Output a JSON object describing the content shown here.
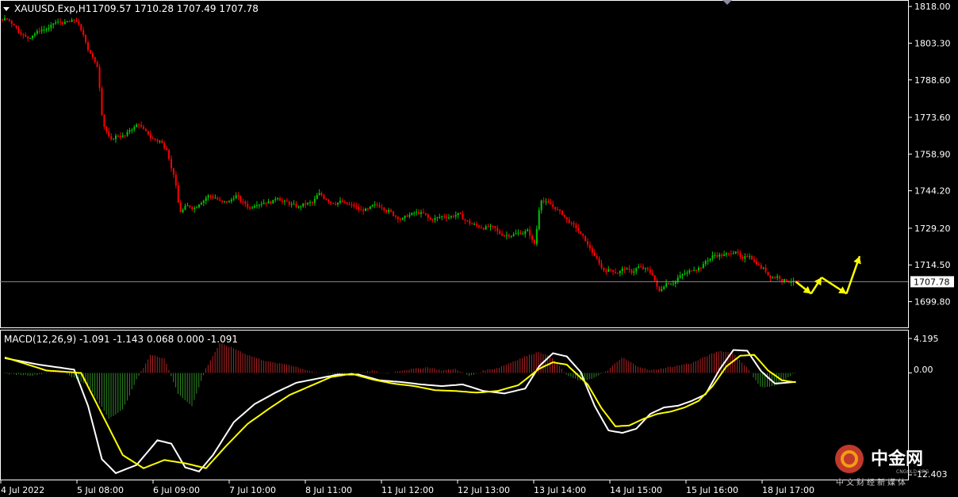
{
  "header": {
    "symbol_tf": "XAUUSD.Exp,H1",
    "ohlc": "1709.57 1710.28 1707.49 1707.78",
    "last_price_badge": "1707.78"
  },
  "macd_header": {
    "label": "MACD(12,26,9) -1.091 -1.143 0.068 0.000 -1.091",
    "top_value": "4.195",
    "zero_value": "0.00",
    "bottom_value": "-12.403"
  },
  "watermark": {
    "brand": "中金网",
    "subtitle": "中文财经新媒体",
    "domain": "CNGOLD.ORG"
  },
  "colors": {
    "background": "#000000",
    "grid_border": "#ffffff",
    "candle_up": "#00c800",
    "candle_down": "#ff0000",
    "macd_hist_pos": "#b22222",
    "macd_hist_neg": "#2e8b22",
    "macd_line": "#ffffff",
    "signal_line": "#ffff00",
    "projection": "#ffff00",
    "price_line": "#8c8ca0"
  },
  "chart_data": [
    {
      "type": "candlestick",
      "title": "XAUUSD.Exp,H1",
      "ylim": [
        1694.9,
        1819.0
      ],
      "y_ticks": [
        1818.0,
        1803.3,
        1788.6,
        1773.6,
        1758.9,
        1744.2,
        1729.2,
        1714.5,
        1699.8
      ],
      "x_tick_labels": [
        "4 Jul 2022",
        "5 Jul 08:00",
        "6 Jul 09:00",
        "7 Jul 10:00",
        "8 Jul 11:00",
        "11 Jul 12:00",
        "12 Jul 13:00",
        "13 Jul 14:00",
        "14 Jul 15:00",
        "15 Jul 16:00",
        "18 Jul 17:00"
      ],
      "close_path": [
        [
          0,
          1813
        ],
        [
          3,
          1806
        ],
        [
          6,
          1810
        ],
        [
          9,
          1812
        ],
        [
          10,
          1813
        ],
        [
          11,
          1806
        ],
        [
          12,
          1799
        ],
        [
          13,
          1795
        ],
        [
          14,
          1770
        ],
        [
          15,
          1765
        ],
        [
          17,
          1767
        ],
        [
          19,
          1771
        ],
        [
          21,
          1766
        ],
        [
          23,
          1760
        ],
        [
          24,
          1752
        ],
        [
          25,
          1736
        ],
        [
          27,
          1738
        ],
        [
          29,
          1742
        ],
        [
          31,
          1740
        ],
        [
          33,
          1741
        ],
        [
          35,
          1738
        ],
        [
          37,
          1740
        ],
        [
          39,
          1741
        ],
        [
          41,
          1739
        ],
        [
          43,
          1738
        ],
        [
          45,
          1742
        ],
        [
          47,
          1740
        ],
        [
          49,
          1739
        ],
        [
          51,
          1736
        ],
        [
          53,
          1739
        ],
        [
          55,
          1737
        ],
        [
          57,
          1733
        ],
        [
          59,
          1735
        ],
        [
          61,
          1733
        ],
        [
          63,
          1734
        ],
        [
          65,
          1734
        ],
        [
          67,
          1731
        ],
        [
          69,
          1730
        ],
        [
          71,
          1728
        ],
        [
          73,
          1726
        ],
        [
          75,
          1727
        ],
        [
          76,
          1722
        ],
        [
          77,
          1740
        ],
        [
          79,
          1737
        ],
        [
          81,
          1733
        ],
        [
          82,
          1730
        ],
        [
          84,
          1722
        ],
        [
          86,
          1712
        ],
        [
          87,
          1712
        ],
        [
          89,
          1712
        ],
        [
          91,
          1714
        ],
        [
          93,
          1711
        ],
        [
          94,
          1705
        ],
        [
          95,
          1706
        ],
        [
          97,
          1709
        ],
        [
          99,
          1713
        ],
        [
          101,
          1716
        ],
        [
          103,
          1719
        ],
        [
          105,
          1721
        ],
        [
          106,
          1716
        ],
        [
          107,
          1718
        ],
        [
          109,
          1712
        ],
        [
          111,
          1709
        ],
        [
          113,
          1709
        ],
        [
          114,
          1707.78
        ]
      ],
      "last_price": 1707.78,
      "projection_path": [
        [
          114,
          1707.78
        ],
        [
          116.2,
          1703
        ],
        [
          117.7,
          1709.5
        ],
        [
          121.3,
          1703
        ],
        [
          123.2,
          1718
        ]
      ]
    },
    {
      "type": "macd",
      "title": "MACD(12,26,9)",
      "values": {
        "macd": -1.091,
        "signal": -1.143,
        "histogram": 0.068,
        "zero": 0.0,
        "osma": -1.091
      },
      "ylim": [
        -12.403,
        4.195
      ],
      "macd_path": [
        [
          0,
          1.8
        ],
        [
          5,
          1.0
        ],
        [
          10,
          0.4
        ],
        [
          12,
          -4.0
        ],
        [
          14,
          -10.5
        ],
        [
          16,
          -12.2
        ],
        [
          19,
          -11.2
        ],
        [
          22,
          -8.2
        ],
        [
          24,
          -8.6
        ],
        [
          26,
          -11.5
        ],
        [
          28,
          -12.0
        ],
        [
          30,
          -10.0
        ],
        [
          33,
          -6.0
        ],
        [
          36,
          -3.8
        ],
        [
          39,
          -2.4
        ],
        [
          42,
          -1.2
        ],
        [
          45,
          -0.7
        ],
        [
          48,
          -0.2
        ],
        [
          51,
          -0.2
        ],
        [
          54,
          -0.9
        ],
        [
          57,
          -1.1
        ],
        [
          60,
          -1.4
        ],
        [
          63,
          -1.6
        ],
        [
          66,
          -1.4
        ],
        [
          69,
          -2.2
        ],
        [
          72,
          -2.5
        ],
        [
          75,
          -1.9
        ],
        [
          77,
          0.8
        ],
        [
          79,
          2.4
        ],
        [
          81,
          2.0
        ],
        [
          83,
          0.1
        ],
        [
          85,
          -4.0
        ],
        [
          87,
          -7.0
        ],
        [
          89,
          -7.3
        ],
        [
          91,
          -6.8
        ],
        [
          93,
          -5.0
        ],
        [
          95,
          -4.2
        ],
        [
          97,
          -4.0
        ],
        [
          99,
          -3.4
        ],
        [
          101,
          -2.6
        ],
        [
          103,
          0.4
        ],
        [
          105,
          2.8
        ],
        [
          107,
          2.7
        ],
        [
          109,
          0.2
        ],
        [
          111,
          -1.3
        ],
        [
          114,
          -1.091
        ]
      ],
      "signal_path": [
        [
          0,
          1.9
        ],
        [
          6,
          0.3
        ],
        [
          11,
          0.0
        ],
        [
          14,
          -5.0
        ],
        [
          17,
          -10.0
        ],
        [
          20,
          -11.6
        ],
        [
          23,
          -10.6
        ],
        [
          26,
          -11.0
        ],
        [
          29,
          -11.6
        ],
        [
          32,
          -8.8
        ],
        [
          35,
          -6.2
        ],
        [
          38,
          -4.4
        ],
        [
          41,
          -2.7
        ],
        [
          44,
          -1.6
        ],
        [
          47,
          -0.5
        ],
        [
          50,
          -0.1
        ],
        [
          53,
          -0.8
        ],
        [
          56,
          -1.3
        ],
        [
          59,
          -1.6
        ],
        [
          62,
          -2.1
        ],
        [
          65,
          -2.2
        ],
        [
          68,
          -2.4
        ],
        [
          71,
          -2.2
        ],
        [
          74,
          -1.5
        ],
        [
          77,
          0.5
        ],
        [
          79,
          1.3
        ],
        [
          81,
          1.0
        ],
        [
          84,
          -1.4
        ],
        [
          86,
          -4.3
        ],
        [
          88,
          -6.5
        ],
        [
          90,
          -6.4
        ],
        [
          92,
          -5.6
        ],
        [
          94,
          -5.0
        ],
        [
          96,
          -4.7
        ],
        [
          98,
          -4.2
        ],
        [
          100,
          -3.4
        ],
        [
          102,
          -1.6
        ],
        [
          104,
          0.8
        ],
        [
          106,
          2.1
        ],
        [
          108,
          2.2
        ],
        [
          110,
          0.3
        ],
        [
          112,
          -0.9
        ],
        [
          114,
          -1.143
        ]
      ],
      "histogram_path": [
        [
          0,
          -0.1
        ],
        [
          4,
          -0.3
        ],
        [
          8,
          0.3
        ],
        [
          12,
          -1.5
        ],
        [
          15,
          -5.5
        ],
        [
          17,
          -4.5
        ],
        [
          19,
          -0.8
        ],
        [
          21,
          2.2
        ],
        [
          23,
          1.8
        ],
        [
          25,
          -2.6
        ],
        [
          27,
          -4.0
        ],
        [
          29,
          0.6
        ],
        [
          31,
          3.6
        ],
        [
          33,
          3.0
        ],
        [
          35,
          2.2
        ],
        [
          37,
          1.6
        ],
        [
          39,
          1.2
        ],
        [
          41,
          1.0
        ],
        [
          43,
          0.5
        ],
        [
          45,
          0.0
        ],
        [
          47,
          -0.1
        ],
        [
          49,
          -0.2
        ],
        [
          51,
          -0.1
        ],
        [
          53,
          0.3
        ],
        [
          55,
          -0.1
        ],
        [
          57,
          0.3
        ],
        [
          59,
          0.5
        ],
        [
          61,
          0.7
        ],
        [
          63,
          0.3
        ],
        [
          65,
          0.5
        ],
        [
          67,
          -0.4
        ],
        [
          69,
          0.3
        ],
        [
          71,
          0.6
        ],
        [
          73,
          1.3
        ],
        [
          75,
          2.0
        ],
        [
          77,
          2.6
        ],
        [
          79,
          1.8
        ],
        [
          81,
          -0.3
        ],
        [
          83,
          -1.0
        ],
        [
          85,
          -0.6
        ],
        [
          87,
          0.4
        ],
        [
          89,
          1.9
        ],
        [
          91,
          0.9
        ],
        [
          93,
          0.3
        ],
        [
          95,
          0.6
        ],
        [
          97,
          0.9
        ],
        [
          99,
          1.2
        ],
        [
          101,
          2.0
        ],
        [
          103,
          2.7
        ],
        [
          105,
          2.4
        ],
        [
          107,
          0.6
        ],
        [
          109,
          -1.8
        ],
        [
          111,
          -1.6
        ],
        [
          113,
          -0.4
        ],
        [
          114,
          0.068
        ]
      ]
    }
  ]
}
